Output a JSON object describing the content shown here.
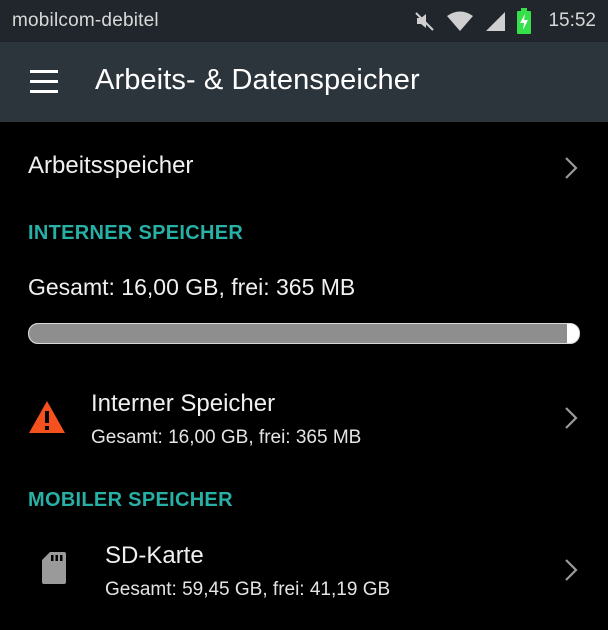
{
  "status_bar": {
    "carrier": "mobilcom-debitel",
    "time": "15:52",
    "icons": [
      "mute-icon",
      "wifi-icon",
      "signal-icon",
      "battery-charging-icon"
    ],
    "battery_color": "#35e04b"
  },
  "toolbar": {
    "title": "Arbeits- & Datenspeicher",
    "menu_icon": "menu-icon"
  },
  "memory_row": {
    "label": "Arbeitsspeicher"
  },
  "internal": {
    "header": "INTERNER SPEICHER",
    "summary": "Gesamt: 16,00 GB, frei: 365 MB",
    "used_fraction": 0.978,
    "item": {
      "title": "Interner Speicher",
      "subtitle": "Gesamt: 16,00 GB, frei: 365 MB",
      "icon": "warning-icon",
      "icon_color": "#f4511e"
    }
  },
  "mobile": {
    "header": "MOBILER SPEICHER",
    "item": {
      "title": "SD-Karte",
      "subtitle": "Gesamt: 59,45 GB, frei: 41,19 GB",
      "icon": "sd-card-icon"
    }
  },
  "colors": {
    "accent": "#26b0a6",
    "toolbar": "#2c353c",
    "statusbar": "#20262b",
    "background": "#000000"
  }
}
